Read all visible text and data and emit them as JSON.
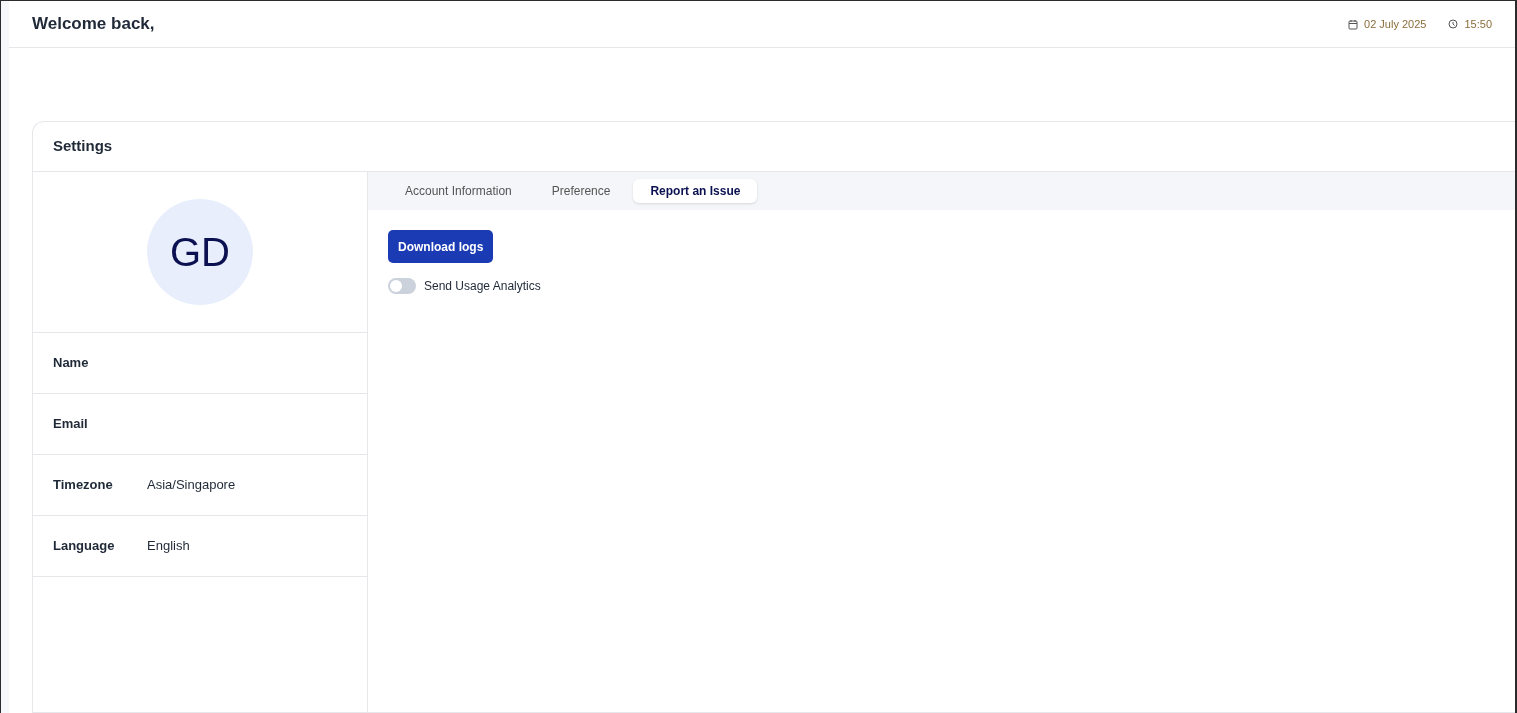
{
  "header": {
    "greeting": "Welcome back,",
    "date": "02 July 2025",
    "time": "15:50"
  },
  "settings": {
    "title": "Settings",
    "avatar_initials": "GD",
    "fields": [
      {
        "label": "Name"
      },
      {
        "label": "Email"
      },
      {
        "label": "Timezone",
        "value": "Asia/Singapore"
      },
      {
        "label": "Language",
        "value": "English"
      }
    ],
    "tabs": [
      {
        "label": "Account Information",
        "selected": false
      },
      {
        "label": "Preference",
        "selected": false
      },
      {
        "label": "Report an Issue",
        "selected": true
      }
    ],
    "download_button": "Download logs",
    "analytics_toggle": {
      "label": "Send Usage Analytics",
      "on": false
    }
  }
}
